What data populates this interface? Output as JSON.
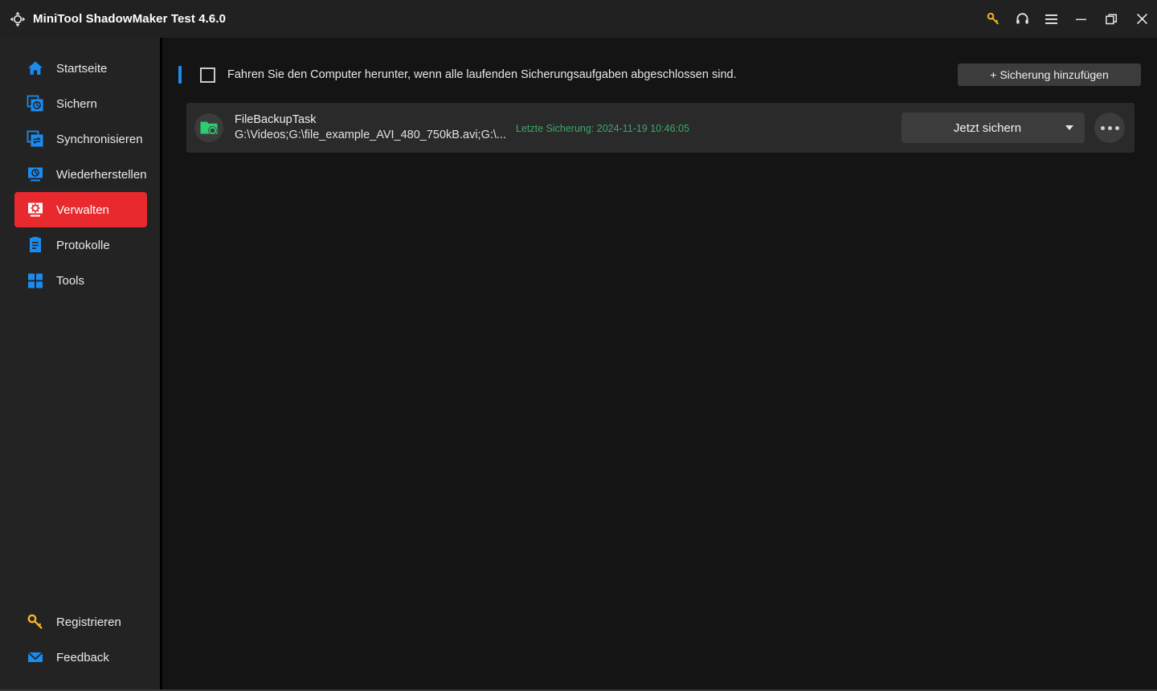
{
  "window": {
    "title": "MiniTool ShadowMaker Test 4.6.0",
    "logo_icon": "sync-arrows-icon",
    "controls": [
      {
        "name": "key-icon",
        "label": "Registrieren"
      },
      {
        "name": "headset-icon",
        "label": "Support"
      },
      {
        "name": "hamburger-menu-icon",
        "label": "Menü"
      },
      {
        "name": "minimize-icon",
        "label": "Minimieren"
      },
      {
        "name": "restore-icon",
        "label": "Wiederherstellen"
      },
      {
        "name": "close-icon",
        "label": "Schließen"
      }
    ]
  },
  "sidebar": {
    "items": [
      {
        "label": "Startseite",
        "icon": "home-icon",
        "active": false
      },
      {
        "label": "Sichern",
        "icon": "backup-icon",
        "active": false
      },
      {
        "label": "Synchronisieren",
        "icon": "sync-icon",
        "active": false
      },
      {
        "label": "Wiederherstellen",
        "icon": "restore-disk-icon",
        "active": false
      },
      {
        "label": "Verwalten",
        "icon": "manage-monitor-icon",
        "active": true
      },
      {
        "label": "Protokolle",
        "icon": "logs-icon",
        "active": false
      },
      {
        "label": "Tools",
        "icon": "tools-grid-icon",
        "active": false
      }
    ],
    "bottom_items": [
      {
        "label": "Registrieren",
        "icon": "key-icon"
      },
      {
        "label": "Feedback",
        "icon": "envelope-icon"
      }
    ],
    "active_color": "#e8292e",
    "icon_color": "#1a8cf0"
  },
  "main": {
    "toolbar": {
      "accent_color": "#1a8cf0",
      "checkbox_checked": false,
      "shutdown_label": "Fahren Sie den Computer herunter, wenn alle laufenden Sicherungsaufgaben abgeschlossen sind.",
      "add_backup_label": "+ Sicherung hinzufügen"
    },
    "tasks": [
      {
        "icon": "green-folder-sync-icon",
        "name": "FileBackupTask",
        "path": "G:\\Videos;G:\\file_example_AVI_480_750kB.avi;G:\\...",
        "last_backup": "Letzte Sicherung: 2024-11-19 10:46:05",
        "last_backup_color": "#3aa86a",
        "action_label": "Jetzt sichern",
        "dropdown_icon": "chevron-down-icon",
        "more_icon": "more-options-icon"
      }
    ]
  }
}
